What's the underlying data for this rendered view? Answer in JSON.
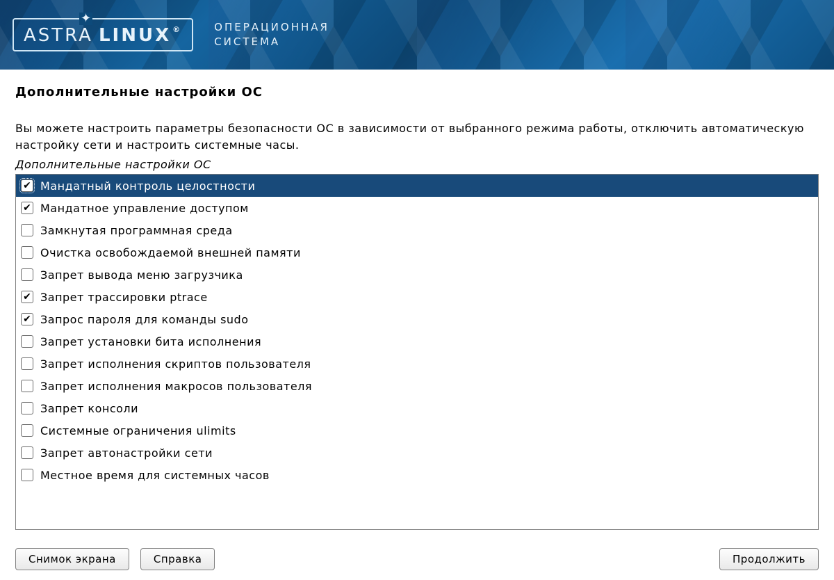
{
  "banner": {
    "logo_word1": "ASTRA",
    "logo_word2": "LINUX",
    "reg_mark": "®",
    "subtitle_line1": "ОПЕРАЦИОННАЯ",
    "subtitle_line2": "СИСТЕМА"
  },
  "page": {
    "title": "Дополнительные настройки ОС",
    "description": "Вы можете настроить параметры безопасности ОС в зависимости от выбранного режима работы, отключить автоматическую настройку сети и настроить системные часы.",
    "list_caption": "Дополнительные настройки ОС"
  },
  "options": [
    {
      "label": "Мандатный контроль целостности",
      "checked": true,
      "selected": true
    },
    {
      "label": "Мандатное управление доступом",
      "checked": true,
      "selected": false
    },
    {
      "label": "Замкнутая программная среда",
      "checked": false,
      "selected": false
    },
    {
      "label": "Очистка освобождаемой внешней памяти",
      "checked": false,
      "selected": false
    },
    {
      "label": "Запрет вывода меню загрузчика",
      "checked": false,
      "selected": false
    },
    {
      "label": "Запрет трассировки ptrace",
      "checked": true,
      "selected": false
    },
    {
      "label": "Запрос пароля для команды sudo",
      "checked": true,
      "selected": false
    },
    {
      "label": "Запрет установки бита исполнения",
      "checked": false,
      "selected": false
    },
    {
      "label": "Запрет исполнения скриптов пользователя",
      "checked": false,
      "selected": false
    },
    {
      "label": "Запрет исполнения макросов пользователя",
      "checked": false,
      "selected": false
    },
    {
      "label": "Запрет консоли",
      "checked": false,
      "selected": false
    },
    {
      "label": "Системные ограничения ulimits",
      "checked": false,
      "selected": false
    },
    {
      "label": "Запрет автонастройки сети",
      "checked": false,
      "selected": false
    },
    {
      "label": "Местное время для системных часов",
      "checked": false,
      "selected": false
    }
  ],
  "buttons": {
    "screenshot": "Снимок экрана",
    "help": "Справка",
    "continue": "Продолжить"
  }
}
